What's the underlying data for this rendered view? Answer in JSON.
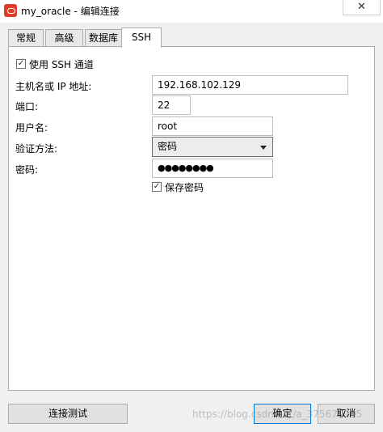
{
  "window": {
    "title": "my_oracle - 编辑连接",
    "close_glyph": "✕"
  },
  "tabs": [
    {
      "label": "常规"
    },
    {
      "label": "高级"
    },
    {
      "label": "数据库"
    },
    {
      "label": "SSH"
    }
  ],
  "active_tab": "SSH",
  "ssh": {
    "use_ssh_label": "使用 SSH 通道",
    "use_ssh_checked": true,
    "host_label": "主机名或 IP 地址:",
    "host_value": "192.168.102.129",
    "port_label": "端口:",
    "port_value": "22",
    "user_label": "用户名:",
    "user_value": "root",
    "auth_label": "验证方法:",
    "auth_value": "密码",
    "password_label": "密码:",
    "password_mask": "●●●●●●●●",
    "save_password_label": "保存密码",
    "save_password_checked": true
  },
  "buttons": {
    "test": "连接测试",
    "ok": "确定",
    "cancel": "取消"
  },
  "watermark": "https://blog.csdn.net/a_375670705",
  "icons": {
    "app": "oracle-icon",
    "check": "✓"
  }
}
